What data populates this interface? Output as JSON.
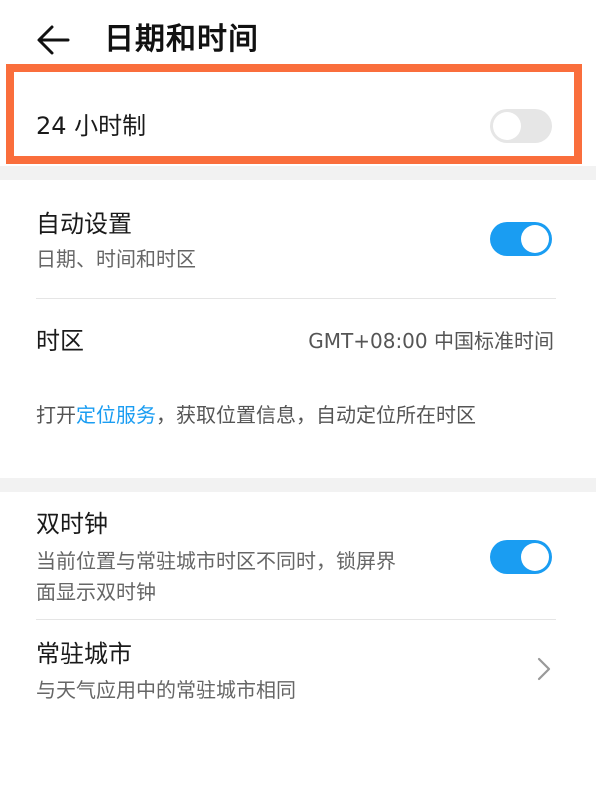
{
  "header": {
    "title": "日期和时间",
    "back_icon": "arrow-left-icon"
  },
  "hour24": {
    "label": "24 小时制",
    "enabled": false
  },
  "auto_set": {
    "label": "自动设置",
    "sublabel": "日期、时间和时区",
    "enabled": true
  },
  "timezone": {
    "label": "时区",
    "value": "GMT+08:00 中国标准时间"
  },
  "hint": {
    "prefix": "打开",
    "link": "定位服务",
    "suffix": "，获取位置信息，自动定位所在时区"
  },
  "dual_clock": {
    "label": "双时钟",
    "sublabel_line1": "当前位置与常驻城市时区不同时，锁屏界",
    "sublabel_line2": "面显示双时钟",
    "enabled": true
  },
  "home_city": {
    "label": "常驻城市",
    "sublabel": "与天气应用中的常驻城市相同",
    "chevron_icon": "chevron-right-icon"
  },
  "colors": {
    "accent": "#1a9df2",
    "highlight_border": "#fa6e3c",
    "toggle_off": "#e6e6e6"
  }
}
